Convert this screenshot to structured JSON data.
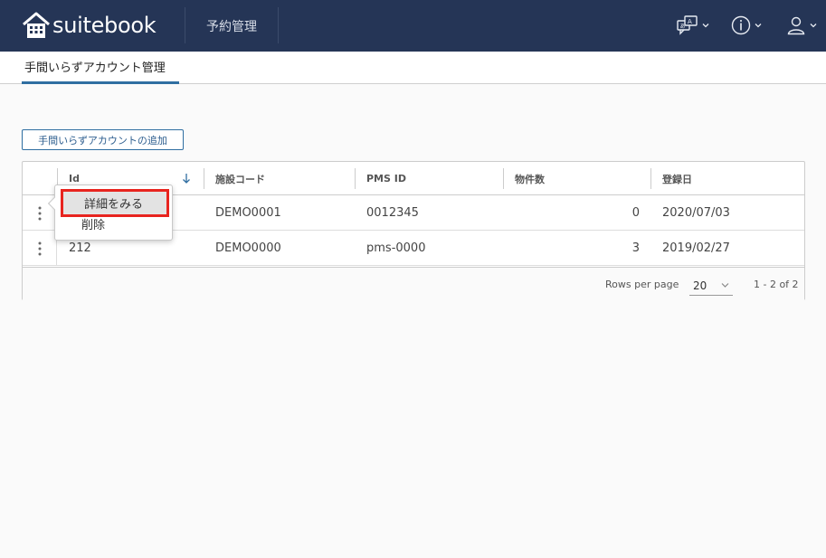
{
  "app": {
    "name": "suitebook",
    "brand_color": "#253556",
    "accent_color": "#2f6ea1",
    "highlight_color": "#e8241f"
  },
  "header": {
    "nav_item": "予約管理",
    "icons": [
      "translate-icon",
      "info-icon",
      "user-icon"
    ]
  },
  "tabs": [
    {
      "label": "手間いらずアカウント管理",
      "active": true
    }
  ],
  "actions": {
    "add_button": "手間いらずアカウントの追加"
  },
  "table": {
    "columns": [
      "Id",
      "施設コード",
      "PMS ID",
      "物件数",
      "登録日"
    ],
    "sorted_column": "Id",
    "sort_direction": "descending",
    "rows": [
      {
        "id": "",
        "facility_code": "DEMO0001",
        "pms_id": "0012345",
        "property_count": "0",
        "registered": "2020/07/03"
      },
      {
        "id": "212",
        "facility_code": "DEMO0000",
        "pms_id": "pms-0000",
        "property_count": "3",
        "registered": "2019/02/27"
      }
    ],
    "footer": {
      "rows_per_page_label": "Rows per page",
      "rows_per_page": "20",
      "range": "1 - 2 of 2"
    }
  },
  "row_menu": {
    "items": [
      "詳細をみる",
      "削除"
    ],
    "highlighted": "詳細をみる"
  }
}
